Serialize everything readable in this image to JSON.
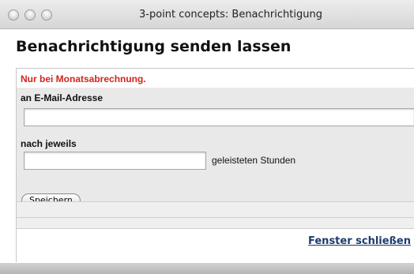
{
  "window": {
    "title": "3-point concepts: Benachrichtigung"
  },
  "page": {
    "heading": "Benachrichtigung senden lassen"
  },
  "form": {
    "hint": "Nur bei Monatsabrechnung.",
    "email_label": "an E-Mail-Adresse",
    "email_value": "",
    "hours_label": "nach jeweils",
    "hours_value": "",
    "hours_suffix": "geleisteten Stunden",
    "save_label": "Speichern"
  },
  "footer": {
    "close_label": "Fenster schließen"
  },
  "colors": {
    "hint": "#d2231c",
    "link": "#1c3c6e",
    "panel_bg": "#e9e9e9"
  }
}
